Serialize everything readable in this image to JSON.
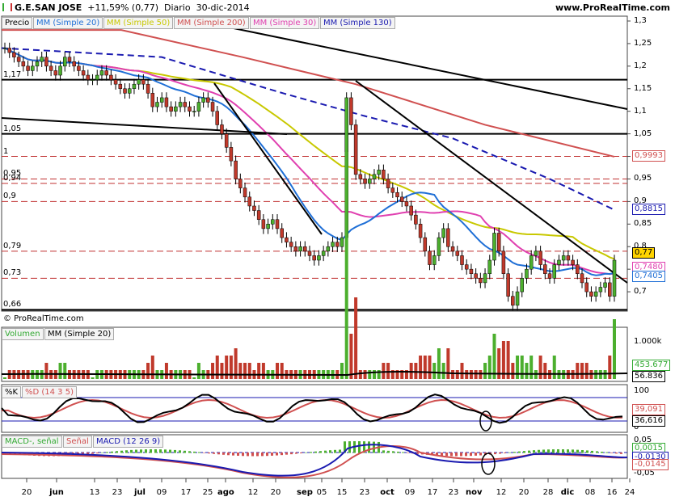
{
  "header": {
    "ticker": "G.E.SAN JOSE",
    "change": "+11,59% (0,77)",
    "period": "Diario",
    "date": "30-dic-2014",
    "site": "www.ProRealTime.com"
  },
  "panels": {
    "price": {
      "legend": [
        "Precio",
        "MM (Simple 20)",
        "MM (Simple 50)",
        "MM (Simple 200)",
        "MM (Simple 30)",
        "MM (Simple 130)"
      ],
      "legend_colors": [
        "#000000",
        "#1f6fd6",
        "#c8c800",
        "#d05050",
        "#e040b0",
        "#1a1ab0"
      ],
      "axis_ticks": [
        "1,3",
        "1,25",
        "1,2",
        "1,15",
        "1,1",
        "1,05",
        "1",
        "0,95",
        "0,9",
        "0,85",
        "0,8",
        "0,75",
        "0,7",
        "0,65"
      ],
      "level_labels": [
        "1,17",
        "1,05",
        "1",
        "0,95",
        "0,94",
        "0,9",
        "0,79",
        "0,73",
        "0,66"
      ],
      "copyright": "© ProRealTime.com",
      "last_values": [
        {
          "text": "0,9993",
          "color": "#d05050"
        },
        {
          "text": "0,8815",
          "color": "#1a1ab0"
        },
        {
          "text": "0,77",
          "color": "#000000"
        },
        {
          "text": "0,7480",
          "color": "#e040b0"
        },
        {
          "text": "0,7405",
          "color": "#1f6fd6"
        }
      ]
    },
    "volume": {
      "legend": [
        "Volumen",
        "MM (Simple 20)"
      ],
      "axis_ticks": [
        "1.000k"
      ],
      "last_values": [
        "453.677",
        "56.836"
      ]
    },
    "stochastic": {
      "legend": [
        "%K",
        "%D (14 3 5)"
      ],
      "axis_ticks": [
        "100",
        "0"
      ],
      "last_values": [
        "39,091",
        "36,616"
      ]
    },
    "macd": {
      "legend": [
        "MACD-, señal",
        "Señal",
        "MACD (12 26 9)"
      ],
      "axis_ticks": [
        "0,05",
        "-0,05"
      ],
      "last_values": [
        "0,0015",
        "-0,0130",
        "-0,0145"
      ]
    }
  },
  "x_axis": [
    "20",
    "jun",
    "13",
    "23",
    "jul",
    "09",
    "17",
    "25",
    "ago",
    "12",
    "20",
    "sep",
    "05",
    "15",
    "23",
    "oct",
    "09",
    "17",
    "23",
    "nov",
    "12",
    "20",
    "28",
    "dic",
    "08",
    "16",
    "24"
  ],
  "chart_data": {
    "type": "candlestick",
    "title": "G.E.SAN JOSE",
    "period": "Diario",
    "last_date": "30-dic-2014",
    "last_close": 0.77,
    "change_pct": 11.59,
    "ylim": [
      0.65,
      1.3
    ],
    "horizontal_levels": [
      1.17,
      1.05,
      1.0,
      0.95,
      0.94,
      0.9,
      0.79,
      0.73,
      0.66
    ],
    "moving_averages": [
      {
        "name": "MM (Simple 20)",
        "last": 0.7405
      },
      {
        "name": "MM (Simple 30)",
        "last": 0.748
      },
      {
        "name": "MM (Simple 130)",
        "last": 0.8815
      },
      {
        "name": "MM (Simple 200)",
        "last": 0.9993
      }
    ],
    "close_series": [
      1.24,
      1.23,
      1.22,
      1.21,
      1.2,
      1.19,
      1.2,
      1.21,
      1.22,
      1.2,
      1.19,
      1.18,
      1.2,
      1.22,
      1.21,
      1.2,
      1.19,
      1.18,
      1.17,
      1.17,
      1.18,
      1.19,
      1.18,
      1.17,
      1.16,
      1.15,
      1.14,
      1.15,
      1.16,
      1.17,
      1.16,
      1.14,
      1.11,
      1.12,
      1.13,
      1.11,
      1.1,
      1.11,
      1.12,
      1.11,
      1.1,
      1.1,
      1.12,
      1.13,
      1.12,
      1.1,
      1.07,
      1.05,
      1.02,
      0.99,
      0.95,
      0.93,
      0.91,
      0.89,
      0.88,
      0.86,
      0.84,
      0.85,
      0.86,
      0.84,
      0.82,
      0.81,
      0.8,
      0.79,
      0.8,
      0.79,
      0.78,
      0.77,
      0.78,
      0.79,
      0.8,
      0.81,
      0.8,
      0.82,
      1.13,
      1.07,
      0.96,
      0.95,
      0.94,
      0.95,
      0.96,
      0.97,
      0.95,
      0.93,
      0.92,
      0.91,
      0.9,
      0.89,
      0.87,
      0.85,
      0.82,
      0.79,
      0.76,
      0.78,
      0.82,
      0.84,
      0.8,
      0.79,
      0.78,
      0.76,
      0.75,
      0.74,
      0.73,
      0.72,
      0.74,
      0.77,
      0.83,
      0.79,
      0.74,
      0.69,
      0.67,
      0.7,
      0.73,
      0.75,
      0.78,
      0.79,
      0.76,
      0.74,
      0.73,
      0.76,
      0.77,
      0.78,
      0.77,
      0.76,
      0.74,
      0.72,
      0.7,
      0.69,
      0.7,
      0.71,
      0.72,
      0.69,
      0.77
    ],
    "volume_ma_last": 56836,
    "volume_last": 453677,
    "stochastic": {
      "k_last": 39.091,
      "d_last": 36.616
    },
    "macd": {
      "histogram_last": 0.0015,
      "signal_last": -0.013,
      "macd_last": -0.0145
    }
  }
}
